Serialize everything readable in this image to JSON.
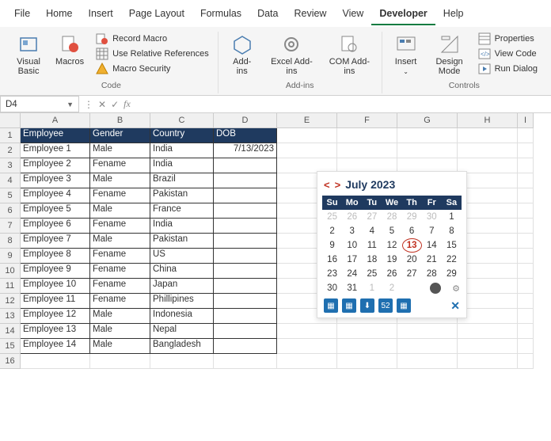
{
  "menu": {
    "items": [
      "File",
      "Home",
      "Insert",
      "Page Layout",
      "Formulas",
      "Data",
      "Review",
      "View",
      "Developer",
      "Help"
    ],
    "active": 8
  },
  "ribbon": {
    "code": {
      "label": "Code",
      "visual_basic": "Visual\nBasic",
      "macros": "Macros",
      "record_macro": "Record Macro",
      "use_relative": "Use Relative References",
      "macro_security": "Macro Security"
    },
    "addins": {
      "label": "Add-ins",
      "addins": "Add-\nins",
      "excel_addins": "Excel\nAdd-ins",
      "com_addins": "COM\nAdd-ins"
    },
    "controls": {
      "label": "Controls",
      "insert": "Insert",
      "design_mode": "Design\nMode",
      "properties": "Properties",
      "view_code": "View Code",
      "run_dialog": "Run Dialog"
    }
  },
  "namebox": "D4",
  "columns": [
    "A",
    "B",
    "C",
    "D",
    "E",
    "F",
    "G",
    "H",
    "I"
  ],
  "header_row": [
    "Employee",
    "Gender",
    "Country",
    "DOB"
  ],
  "rows": [
    [
      "Employee 1",
      "Male",
      "India",
      "7/13/2023"
    ],
    [
      "Employee 2",
      "Fename",
      "India",
      ""
    ],
    [
      "Employee 3",
      "Male",
      "Brazil",
      ""
    ],
    [
      "Employee 4",
      "Fename",
      "Pakistan",
      ""
    ],
    [
      "Employee 5",
      "Male",
      "France",
      ""
    ],
    [
      "Employee 6",
      "Fename",
      "India",
      ""
    ],
    [
      "Employee 7",
      "Male",
      "Pakistan",
      ""
    ],
    [
      "Employee 8",
      "Fename",
      "US",
      ""
    ],
    [
      "Employee 9",
      "Fename",
      "China",
      ""
    ],
    [
      "Employee 10",
      "Fename",
      "Japan",
      ""
    ],
    [
      "Employee 11",
      "Fename",
      "Phillipines",
      ""
    ],
    [
      "Employee 12",
      "Male",
      "Indonesia",
      ""
    ],
    [
      "Employee 13",
      "Male",
      "Nepal",
      ""
    ],
    [
      "Employee 14",
      "Male",
      "Bangladesh",
      ""
    ]
  ],
  "datepicker": {
    "title": "July 2023",
    "dow": [
      "Su",
      "Mo",
      "Tu",
      "We",
      "Th",
      "Fr",
      "Sa"
    ],
    "days": [
      {
        "n": 25,
        "o": 1
      },
      {
        "n": 26,
        "o": 1
      },
      {
        "n": 27,
        "o": 1
      },
      {
        "n": 28,
        "o": 1
      },
      {
        "n": 29,
        "o": 1
      },
      {
        "n": 30,
        "o": 1
      },
      {
        "n": 1
      },
      {
        "n": 2
      },
      {
        "n": 3
      },
      {
        "n": 4
      },
      {
        "n": 5
      },
      {
        "n": 6
      },
      {
        "n": 7
      },
      {
        "n": 8
      },
      {
        "n": 9
      },
      {
        "n": 10
      },
      {
        "n": 11
      },
      {
        "n": 12
      },
      {
        "n": 13,
        "t": 1
      },
      {
        "n": 14
      },
      {
        "n": 15
      },
      {
        "n": 16
      },
      {
        "n": 17
      },
      {
        "n": 18
      },
      {
        "n": 19
      },
      {
        "n": 20
      },
      {
        "n": 21
      },
      {
        "n": 22
      },
      {
        "n": 23
      },
      {
        "n": 24
      },
      {
        "n": 25
      },
      {
        "n": 26
      },
      {
        "n": 27
      },
      {
        "n": 28
      },
      {
        "n": 29
      },
      {
        "n": 30
      },
      {
        "n": 31
      },
      {
        "n": 1,
        "o": 1
      },
      {
        "n": 2,
        "o": 1
      }
    ],
    "toolbar": [
      "📅",
      "📅",
      "⬇",
      "52",
      "📅"
    ]
  }
}
